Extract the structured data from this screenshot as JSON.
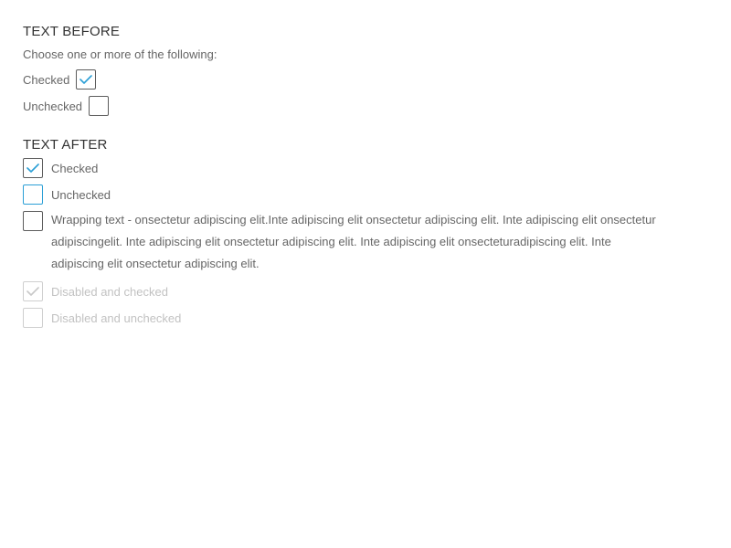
{
  "sections": {
    "before_heading": "TEXT BEFORE",
    "after_heading": "TEXT AFTER"
  },
  "instructions": "Choose one or more of the following:",
  "before_items": [
    {
      "label": "Checked",
      "checked": true
    },
    {
      "label": "Unchecked",
      "checked": false
    }
  ],
  "after_items": [
    {
      "label": "Checked",
      "checked": true,
      "disabled": false
    },
    {
      "label": "Unchecked",
      "checked": false,
      "disabled": false,
      "focused": true
    },
    {
      "label": "Wrapping text - onsectetur adipiscing elit.Inte adipiscing elit onsectetur adipiscing elit. Inte adipiscing elit onsectetur adipiscingelit. Inte adipiscing elit onsectetur adipiscing elit. Inte adipiscing elit onsecteturadipiscing elit. Inte adipiscing elit onsectetur adipiscing elit.",
      "checked": false,
      "disabled": false
    },
    {
      "label": "Disabled and checked",
      "checked": true,
      "disabled": true
    },
    {
      "label": "Disabled and unchecked",
      "checked": false,
      "disabled": true
    }
  ],
  "colors": {
    "check_accent": "#2b9fd6",
    "check_disabled": "#c8c8c8",
    "border": "#5c5c5c",
    "focus_border": "#2b9fd6"
  }
}
